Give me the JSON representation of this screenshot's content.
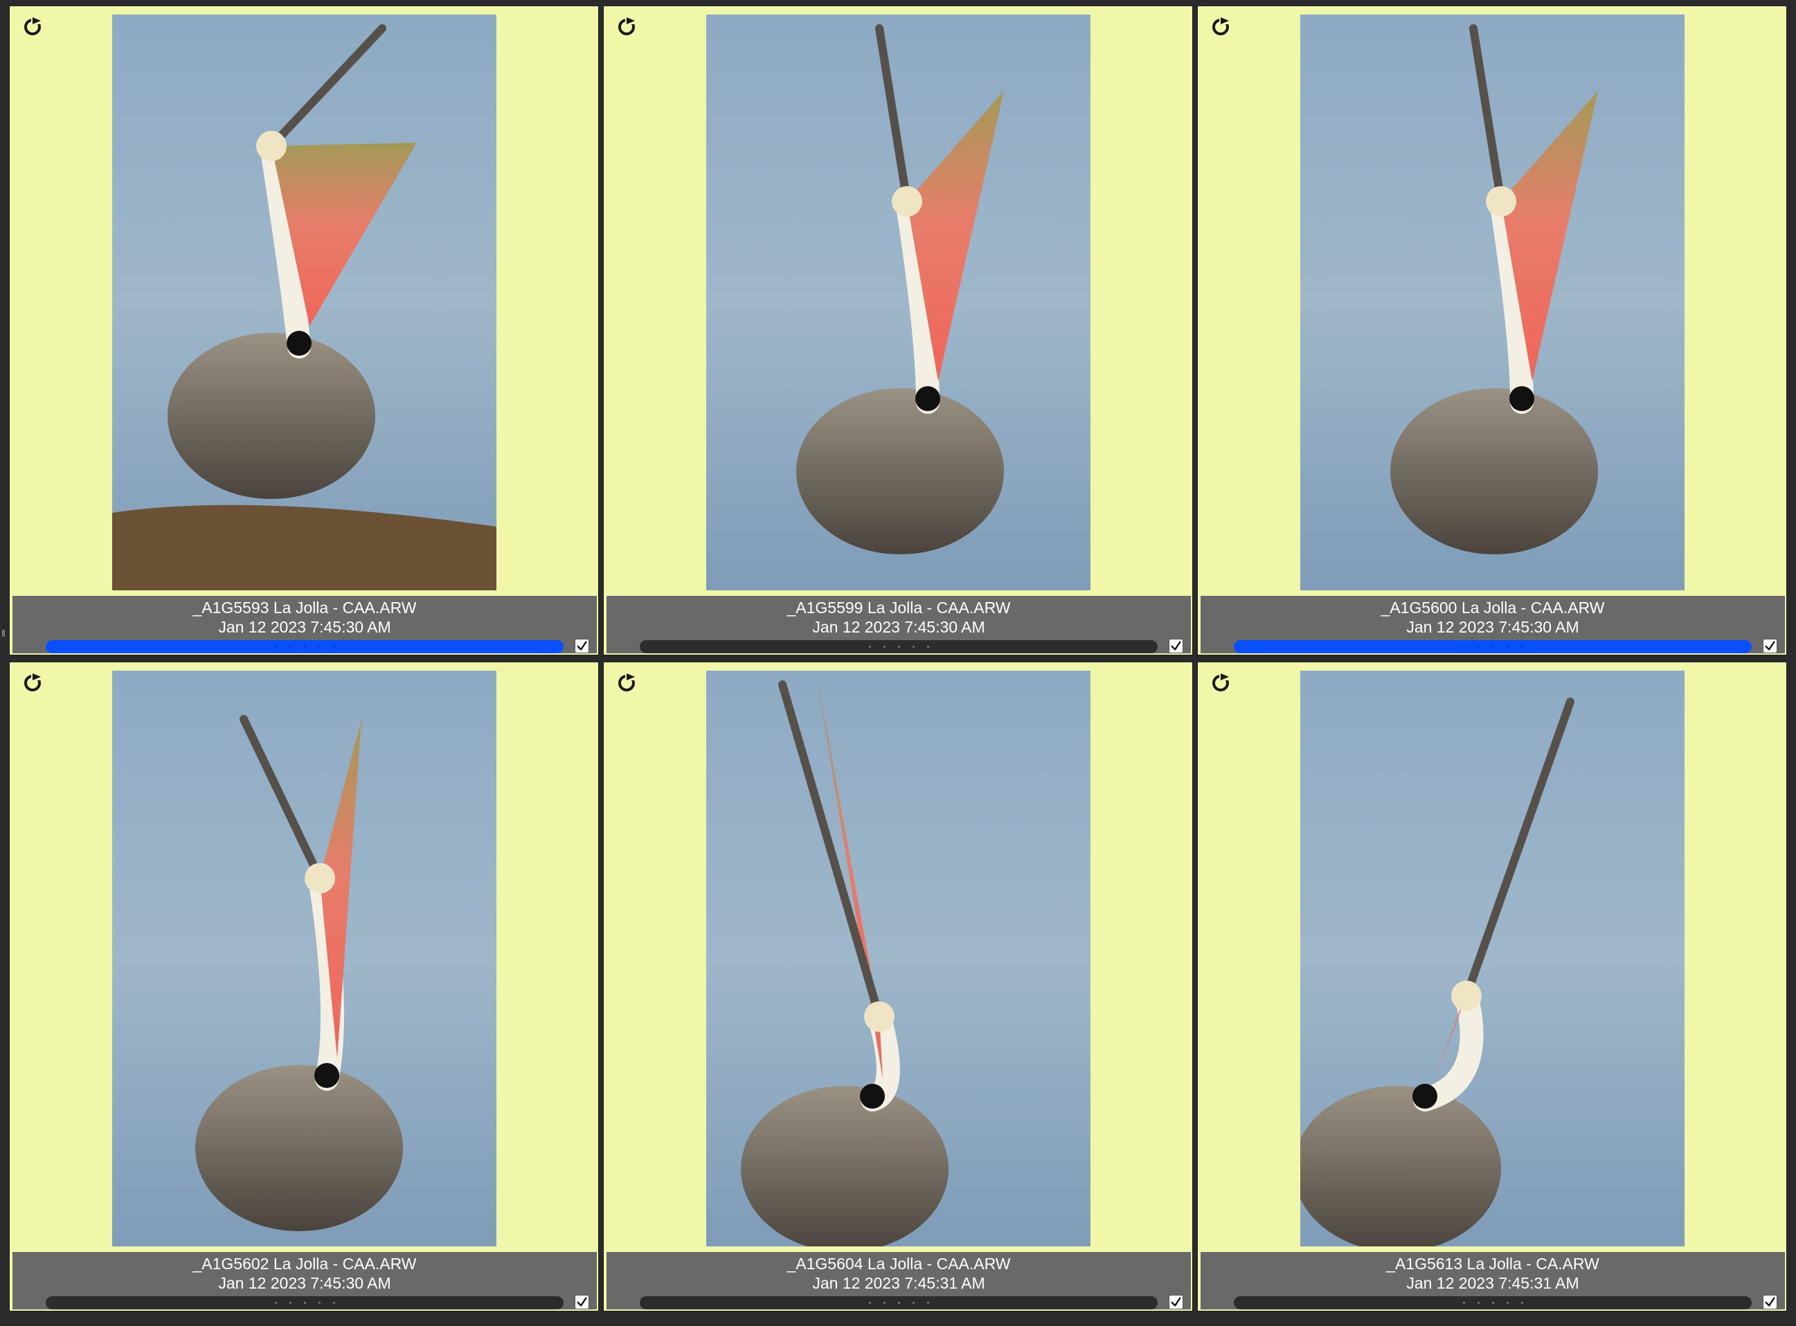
{
  "colors": {
    "cell_background": "#f0f7a8",
    "caption_background": "#696969",
    "label_blue": "#0a4fff",
    "label_none": "#2c2c2c"
  },
  "thumbnails": [
    {
      "filename": "_A1G5593 La Jolla  - CAA.ARW",
      "date": "Jan 12 2023 7:45:30 AM",
      "color_label": "blue",
      "checked": true,
      "rotate_icon": "rotate-icon",
      "pose": "beak-angled-up-on-rock"
    },
    {
      "filename": "_A1G5599 La Jolla  - CAA.ARW",
      "date": "Jan 12 2023 7:45:30 AM",
      "color_label": "none",
      "checked": true,
      "rotate_icon": "rotate-icon",
      "pose": "beak-up-pouch-open"
    },
    {
      "filename": "_A1G5600 La Jolla  - CAA.ARW",
      "date": "Jan 12 2023 7:45:30 AM",
      "color_label": "blue",
      "checked": true,
      "rotate_icon": "rotate-icon",
      "pose": "beak-up-pouch-open"
    },
    {
      "filename": "_A1G5602 La Jolla  - CAA.ARW",
      "date": "Jan 12 2023 7:45:30 AM",
      "color_label": "none",
      "checked": true,
      "rotate_icon": "rotate-icon",
      "pose": "beak-vertical"
    },
    {
      "filename": "_A1G5604 La Jolla  - CAA.ARW",
      "date": "Jan 12 2023 7:45:31 AM",
      "color_label": "none",
      "checked": true,
      "rotate_icon": "rotate-icon",
      "pose": "beak-straight-up"
    },
    {
      "filename": "_A1G5613 La Jolla  - CA.ARW",
      "date": "Jan 12 2023 7:45:31 AM",
      "color_label": "none",
      "checked": true,
      "rotate_icon": "rotate-icon",
      "pose": "beak-straight-up-right"
    }
  ]
}
